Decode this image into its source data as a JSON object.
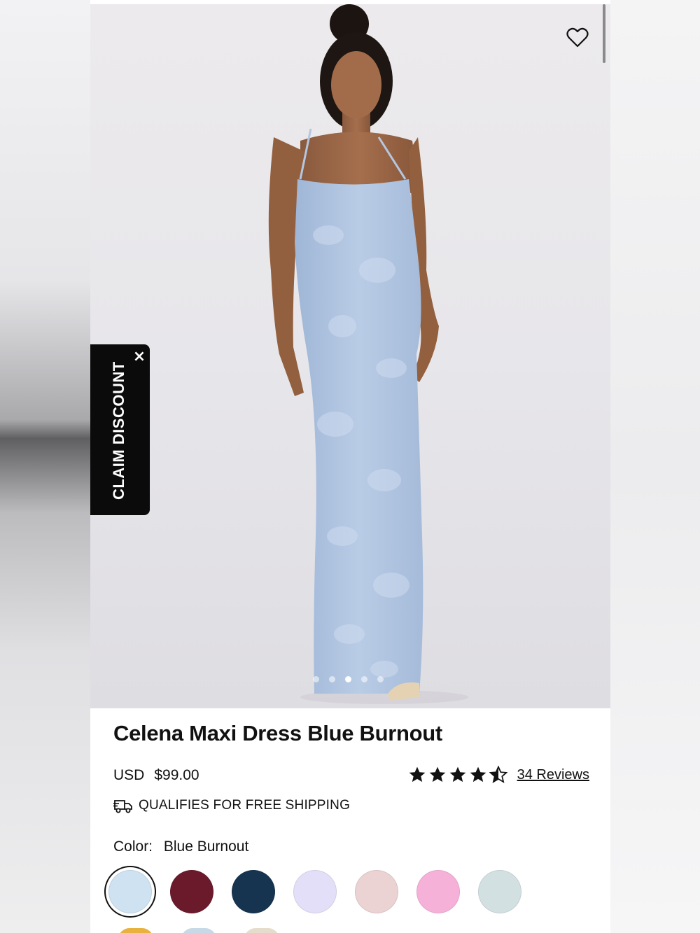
{
  "product": {
    "title": "Celena Maxi Dress Blue Burnout",
    "currency": "USD",
    "price": "$99.00",
    "rating": 4.5,
    "reviews_label": "34 Reviews",
    "shipping_label": "QUALIFIES FOR FREE SHIPPING",
    "color_label": "Color:",
    "color_value": "Blue Burnout"
  },
  "promo": {
    "claim_label": "CLAIM DISCOUNT",
    "close_glyph": "×"
  },
  "gallery": {
    "image_count": 5,
    "active_index": 2
  },
  "swatches": [
    {
      "color": "#cfe2f1",
      "selected": true
    },
    {
      "color": "#6b1a2b",
      "selected": false
    },
    {
      "color": "#16344f",
      "selected": false
    },
    {
      "color": "#e4dff8",
      "selected": false
    },
    {
      "color": "#ebd2d3",
      "selected": false
    },
    {
      "color": "#f6b1d8",
      "selected": false
    },
    {
      "color": "#d3e0e2",
      "selected": false
    }
  ],
  "swatches_row2": [
    "#e9b23e",
    "#c7d8e6",
    "#e6dccb"
  ],
  "icons": {
    "wishlist": "heart-outline-icon",
    "shipping": "delivery-truck-icon",
    "close": "close-icon",
    "star": "star-icon"
  }
}
